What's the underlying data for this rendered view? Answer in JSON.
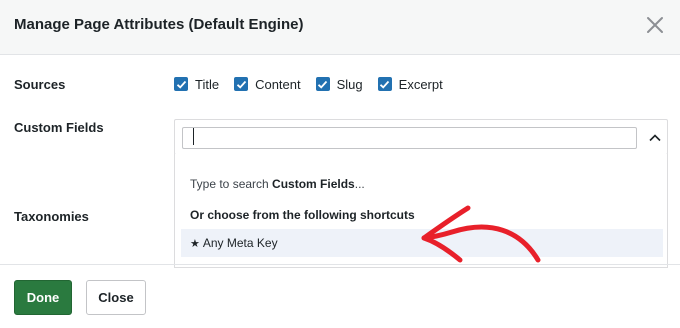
{
  "dialog": {
    "title": "Manage Page Attributes (Default Engine)"
  },
  "sources": {
    "label": "Sources",
    "options": [
      {
        "label": "Title",
        "checked": true
      },
      {
        "label": "Content",
        "checked": true
      },
      {
        "label": "Slug",
        "checked": true
      },
      {
        "label": "Excerpt",
        "checked": true
      }
    ]
  },
  "custom_fields": {
    "label": "Custom Fields",
    "search_value": "",
    "hint_prefix": "Type to search ",
    "hint_bold": "Custom Fields",
    "hint_suffix": "...",
    "shortcuts_heading": "Or choose from the following shortcuts",
    "shortcut_option": "Any Meta Key"
  },
  "taxonomies": {
    "label": "Taxonomies"
  },
  "footer": {
    "done_label": "Done",
    "close_label": "Close"
  },
  "colors": {
    "accent": "#2271b1",
    "done_button": "#2a7a3f",
    "annotation_arrow": "#e8202a"
  }
}
